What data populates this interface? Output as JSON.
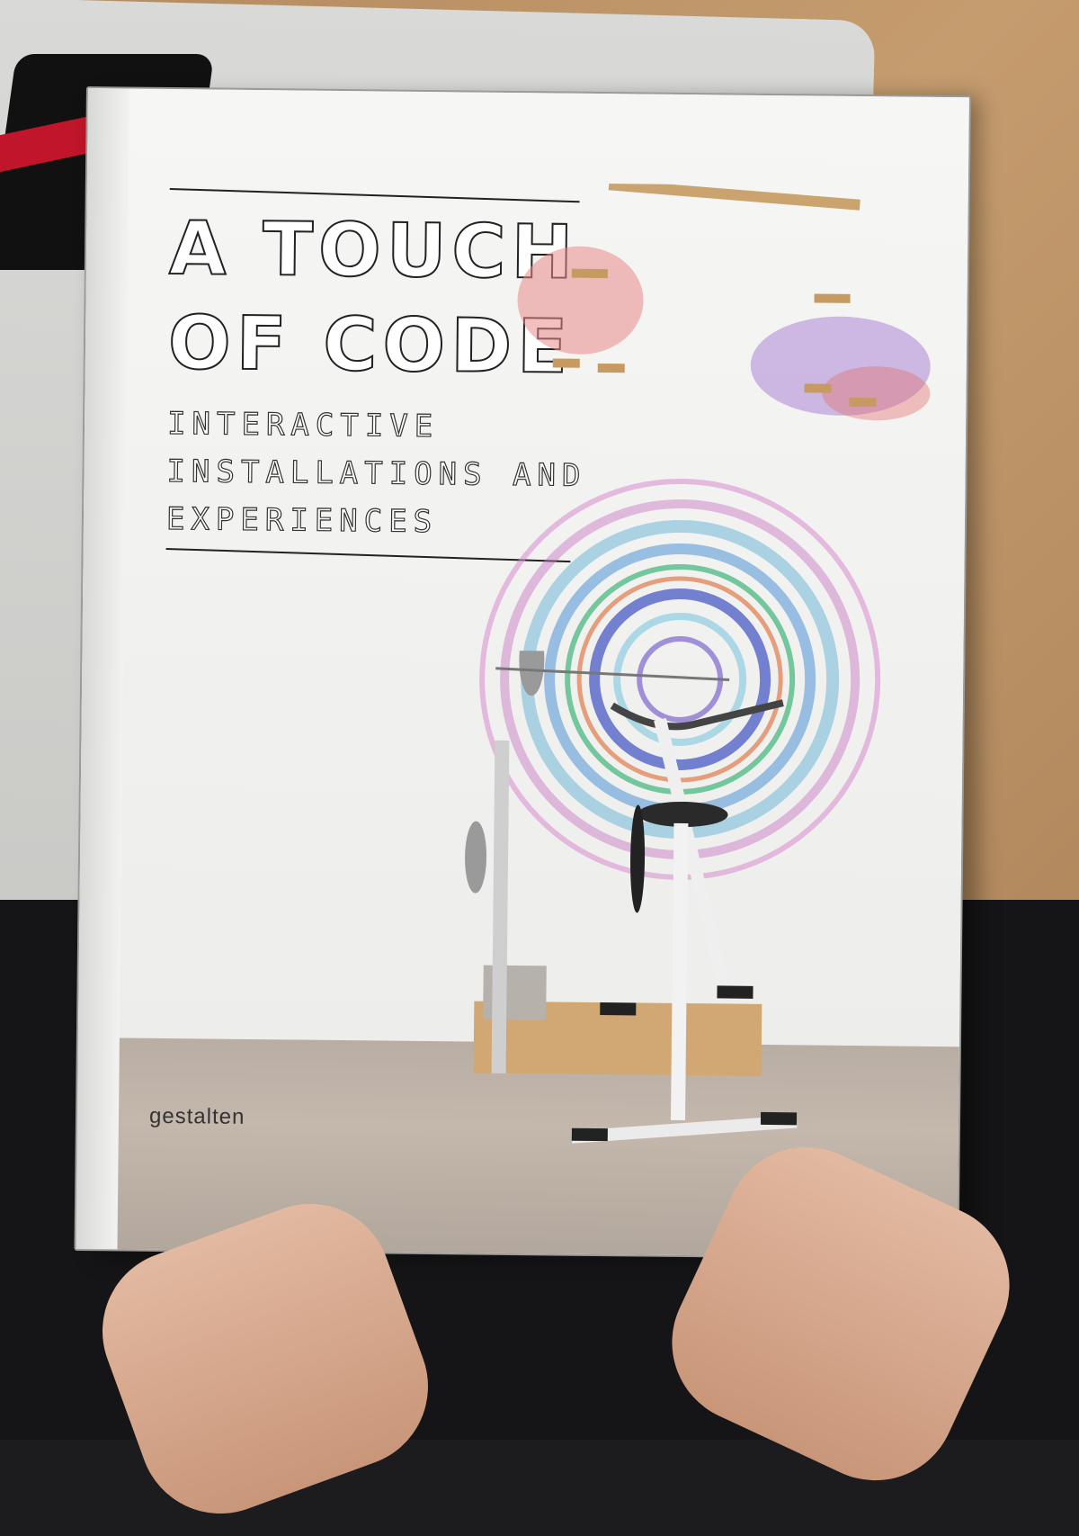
{
  "book": {
    "title_line_1": "A TOUCH",
    "title_line_2": "OF CODE",
    "subtitle_line_1": "INTERACTIVE",
    "subtitle_line_2": "INSTALLATIONS AND",
    "subtitle_line_3": "EXPERIENCES",
    "publisher": "gestalten"
  },
  "colors": {
    "cover": "#f4f4f2",
    "title_stroke": "#222222",
    "floor": "#bdb1a6",
    "table": "#c09869"
  },
  "icons": [
    "exercise-bike-illustration",
    "scribble-circle-art",
    "drawing-machine-art"
  ]
}
